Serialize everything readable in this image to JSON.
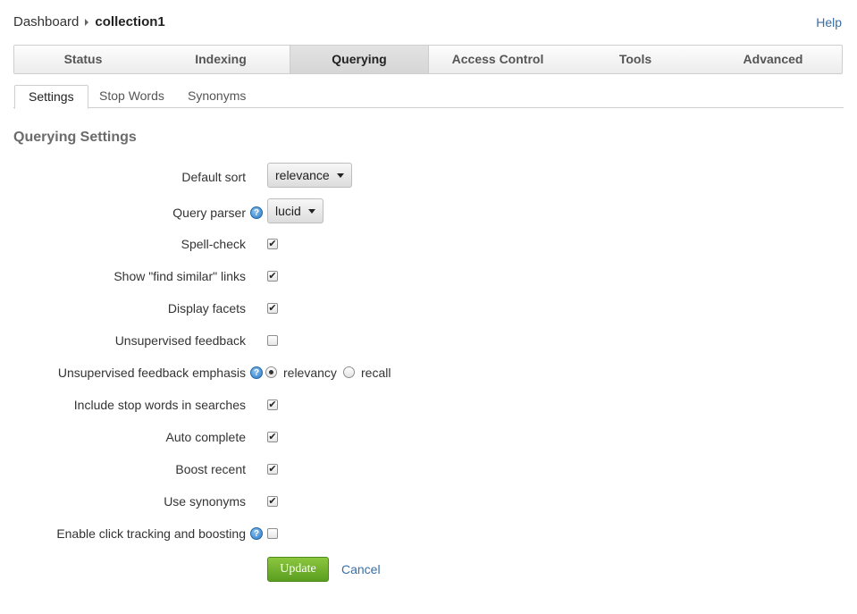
{
  "breadcrumb": {
    "root": "Dashboard",
    "current": "collection1"
  },
  "help": "Help",
  "main_tabs": [
    "Status",
    "Indexing",
    "Querying",
    "Access Control",
    "Tools",
    "Advanced"
  ],
  "sub_tabs": [
    "Settings",
    "Stop Words",
    "Synonyms"
  ],
  "section_title": "Querying Settings",
  "settings": {
    "default_sort": {
      "label": "Default sort",
      "value": "relevance"
    },
    "query_parser": {
      "label": "Query parser",
      "value": "lucid"
    },
    "spell_check": {
      "label": "Spell-check",
      "checked": true
    },
    "find_similar": {
      "label": "Show \"find similar\" links",
      "checked": true
    },
    "display_facets": {
      "label": "Display facets",
      "checked": true
    },
    "unsupervised_feedback": {
      "label": "Unsupervised feedback",
      "checked": false
    },
    "feedback_emphasis": {
      "label": "Unsupervised feedback emphasis",
      "option1": "relevancy",
      "option2": "recall",
      "selected": "relevancy"
    },
    "stop_words": {
      "label": "Include stop words in searches",
      "checked": true
    },
    "auto_complete": {
      "label": "Auto complete",
      "checked": true
    },
    "boost_recent": {
      "label": "Boost recent",
      "checked": true
    },
    "use_synonyms": {
      "label": "Use synonyms",
      "checked": true
    },
    "click_tracking": {
      "label": "Enable click tracking and boosting",
      "checked": false
    }
  },
  "actions": {
    "update": "Update",
    "cancel": "Cancel"
  },
  "icons": {
    "help": "help-circle-icon",
    "check": "✔"
  },
  "colors": {
    "accent_green": "#6bb12b",
    "link_blue": "#3a6ea5",
    "help_icon_blue": "#2b79c2"
  }
}
